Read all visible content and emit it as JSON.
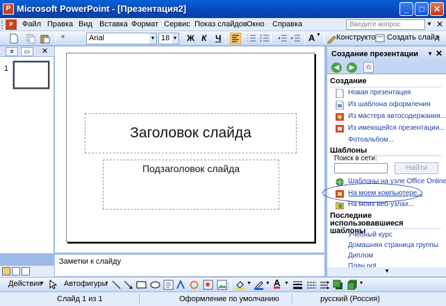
{
  "window": {
    "title": "Microsoft PowerPoint - [Презентация2]",
    "app_icon": "powerpoint-icon",
    "buttons": {
      "minimize": "_",
      "restore": "□",
      "close": "✕"
    }
  },
  "menubar": {
    "items": [
      {
        "label": "Файл"
      },
      {
        "label": "Правка"
      },
      {
        "label": "Вид"
      },
      {
        "label": "Вставка"
      },
      {
        "label": "Формат"
      },
      {
        "label": "Сервис"
      },
      {
        "label": "Показ слайдов"
      },
      {
        "label": "Окно"
      },
      {
        "label": "Справка"
      }
    ],
    "help_placeholder": "Введите вопрос",
    "close_doc": "✕"
  },
  "formatting": {
    "font": "Arial",
    "size": "18",
    "bold": "Ж",
    "italic": "К",
    "underline": "Ч",
    "designer": "Конструктор",
    "new_slide": "Создать слайд"
  },
  "left_pane": {
    "tab_close": "✕",
    "slide_number": "1"
  },
  "slide": {
    "title": "Заголовок слайда",
    "subtitle": "Подзаголовок слайда"
  },
  "notes": {
    "placeholder": "Заметки к слайду"
  },
  "task_pane": {
    "title": "Создание презентации",
    "close": "✕",
    "create_section": "Создание",
    "create_links": [
      {
        "label": "Новая презентация",
        "icon": "blank-doc-icon"
      },
      {
        "label": "Из шаблона оформления",
        "icon": "template-icon"
      },
      {
        "label": "Из мастера автосодержания...",
        "icon": "wizard-icon"
      },
      {
        "label": "Из имеющейся презентации...",
        "icon": "existing-doc-icon"
      },
      {
        "label": "Фотоальбом...",
        "icon": ""
      }
    ],
    "templates_section": "Шаблоны",
    "search_label": "Поиск в сети:",
    "find_button": "Найти",
    "template_links": [
      {
        "label": "Шаблоны на узле Office Online",
        "icon": "globe-icon"
      },
      {
        "label": "На моем компьютере...",
        "icon": "computer-template-icon"
      },
      {
        "label": "На моих веб-узлах...",
        "icon": "web-folder-icon"
      }
    ],
    "recent_section": "Последние использовавшиеся шаблоны",
    "recent_items": [
      "Учебный курс",
      "Домашняя страница группы",
      "Диплом",
      "План.pot"
    ]
  },
  "drawing": {
    "actions": "Действия",
    "autoshapes": "Автофигуры"
  },
  "status": {
    "slide": "Слайд 1 из 1",
    "design": "Оформление по умолчанию",
    "language": "русский (Россия)"
  },
  "colors": {
    "title_bar": "#0a5fd8",
    "link": "#1c3fa8",
    "highlight_oval": "#2a3cb0"
  }
}
